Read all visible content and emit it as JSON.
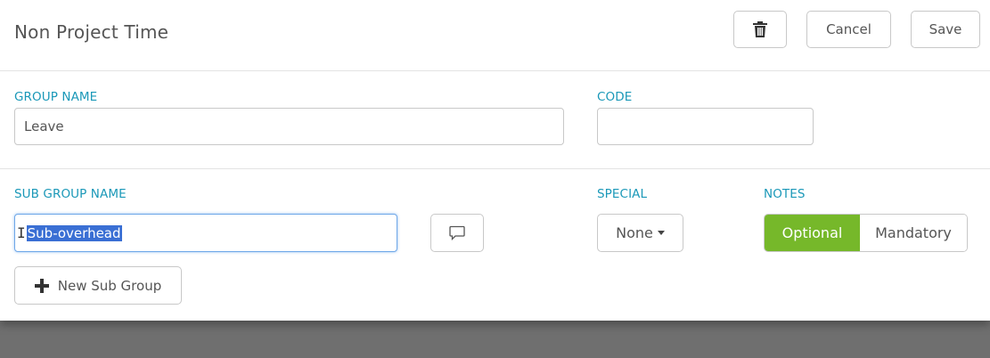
{
  "header": {
    "title": "Non Project Time",
    "delete_icon": "trash-icon",
    "cancel_label": "Cancel",
    "save_label": "Save"
  },
  "group": {
    "name_label": "GROUP NAME",
    "name_value": "Leave",
    "code_label": "CODE",
    "code_value": ""
  },
  "subgroup": {
    "name_label": "SUB GROUP NAME",
    "name_value": "Sub-overhead",
    "comment_icon": "comment-icon",
    "special_label": "SPECIAL",
    "special_value": "None",
    "notes_label": "NOTES",
    "notes_options": [
      "Optional",
      "Mandatory"
    ],
    "notes_selected": "Optional",
    "new_subgroup_label": "New Sub Group"
  },
  "colors": {
    "accent": "#1a98b8",
    "toggle_active": "#76b82a",
    "selection": "#3a6fd4"
  }
}
